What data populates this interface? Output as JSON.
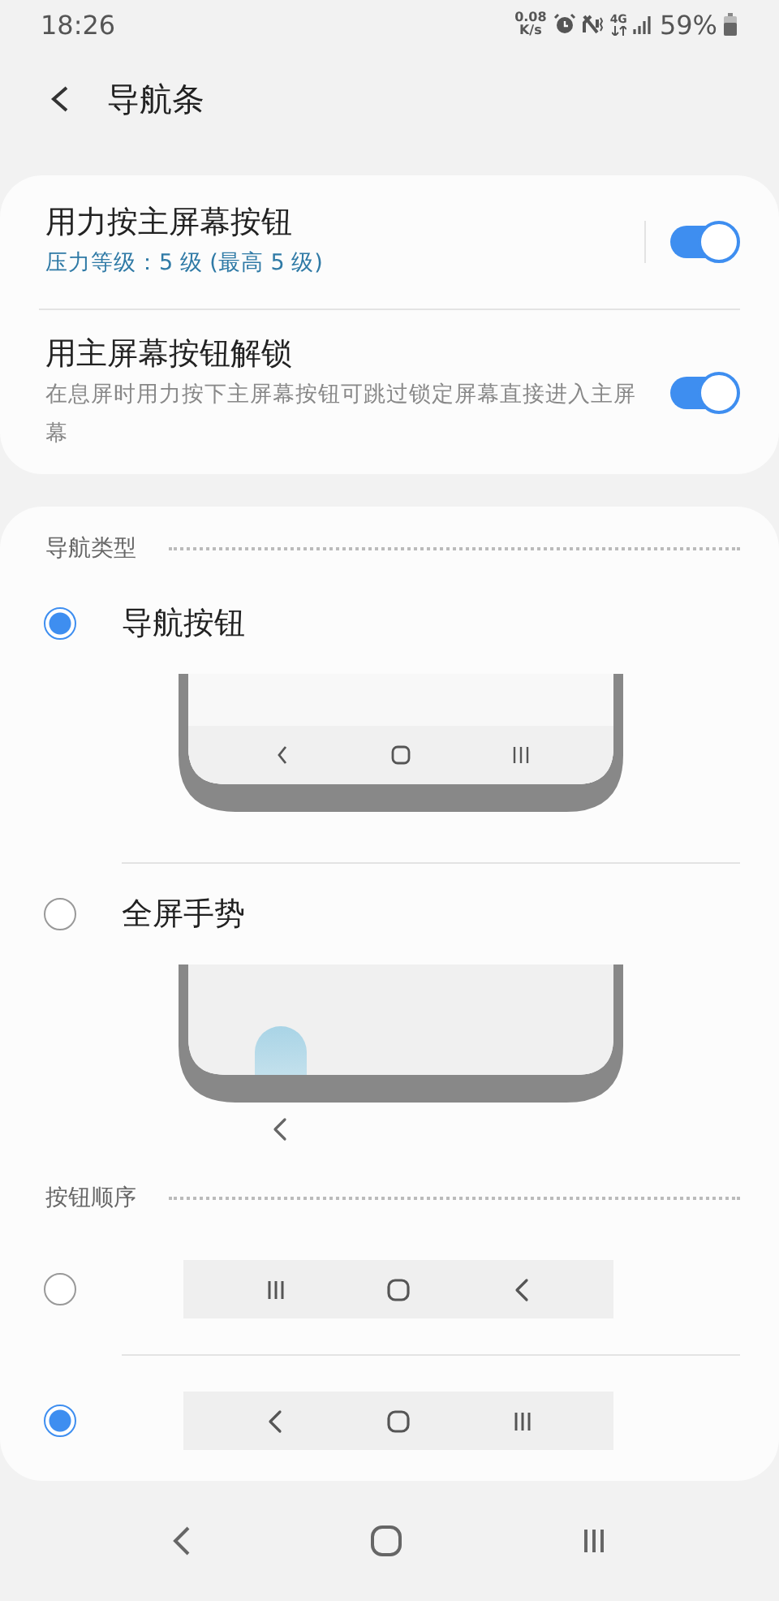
{
  "status_bar": {
    "time": "18:26",
    "net_speed": [
      "0.08",
      "K/s"
    ],
    "network": "4G",
    "battery": "59%"
  },
  "header": {
    "title": "导航条"
  },
  "toggles": [
    {
      "title": "用力按主屏幕按钮",
      "subtitle": "压力等级：5 级 (最高 5 级)",
      "kind": "status",
      "on": true
    },
    {
      "title": "用主屏幕按钮解锁",
      "subtitle": "在息屏时用力按下主屏幕按钮可跳过锁定屏幕直接进入主屏幕",
      "kind": "description",
      "on": true
    }
  ],
  "nav_type": {
    "heading": "导航类型",
    "options": [
      {
        "label": "导航按钮",
        "kind": "buttons",
        "selected": true
      },
      {
        "label": "全屏手势",
        "kind": "gestures",
        "selected": false
      }
    ]
  },
  "button_order": {
    "heading": "按钮顺序",
    "options": [
      {
        "icons": [
          {
            "kind": "recents"
          },
          {
            "kind": "home"
          },
          {
            "kind": "back"
          }
        ],
        "selected": false
      },
      {
        "icons": [
          {
            "kind": "back"
          },
          {
            "kind": "home"
          },
          {
            "kind": "recents"
          }
        ],
        "selected": true
      }
    ]
  }
}
